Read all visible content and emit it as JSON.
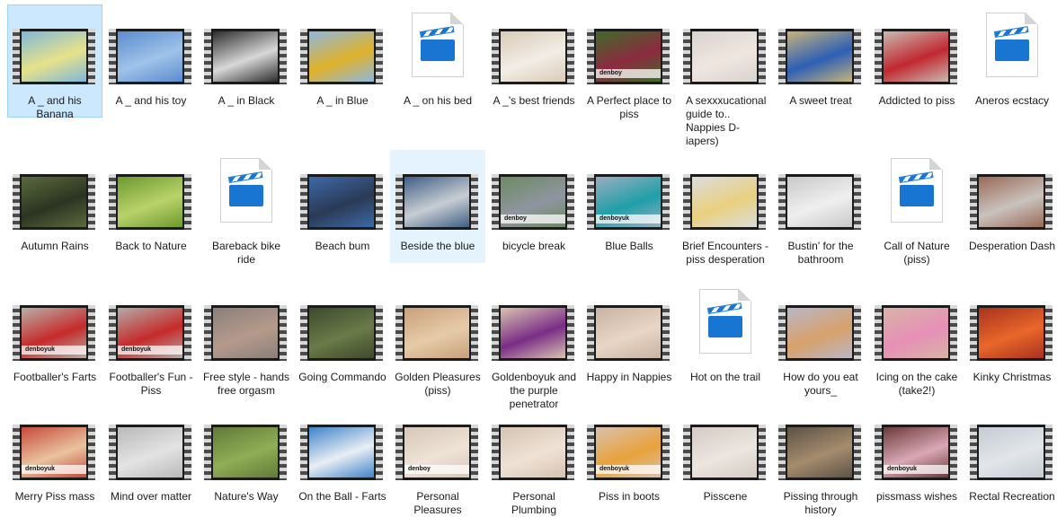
{
  "explorer": {
    "items": [
      {
        "name": "A _ and his Banana",
        "kind": "video",
        "bg": "#7fb7da",
        "fg": "#e7e28a",
        "selected": true
      },
      {
        "name": "A _ and his toy",
        "kind": "video",
        "bg": "#5a8ccf",
        "fg": "#9fc3e9"
      },
      {
        "name": "A _ in Black",
        "kind": "video",
        "bg": "#2d2d2d",
        "fg": "#d8d8d8"
      },
      {
        "name": "A _ in Blue",
        "kind": "video",
        "bg": "#8eb7de",
        "fg": "#e0b22a"
      },
      {
        "name": "A _ on his bed",
        "kind": "file"
      },
      {
        "name": "A _'s best friends",
        "kind": "video",
        "bg": "#d9cbb7",
        "fg": "#f2ede6"
      },
      {
        "name": "A Perfect place to piss",
        "kind": "video",
        "bg": "#3f6b2a",
        "fg": "#8d2a3f",
        "logo": "denboy"
      },
      {
        "name": "A sexxxucational guide to.. Nappies D-iapers)",
        "kind": "video",
        "bg": "#d8d3ce",
        "fg": "#efe6df"
      },
      {
        "name": "A sweet treat",
        "kind": "video",
        "bg": "#c7b37b",
        "fg": "#2c5fb5"
      },
      {
        "name": "Addicted to piss",
        "kind": "video",
        "bg": "#c9b9b1",
        "fg": "#c12830"
      },
      {
        "name": "Aneros ecstacy",
        "kind": "file"
      },
      {
        "name": "Autumn Rains",
        "kind": "video",
        "bg": "#5a6b3e",
        "fg": "#2c3421"
      },
      {
        "name": "Back to Nature",
        "kind": "video",
        "bg": "#6c9a2d",
        "fg": "#b9d26a"
      },
      {
        "name": "Bareback bike ride",
        "kind": "file"
      },
      {
        "name": "Beach bum",
        "kind": "video",
        "bg": "#3e69a8",
        "fg": "#2a3a55"
      },
      {
        "name": "Beside the blue",
        "kind": "video",
        "bg": "#3f5f86",
        "fg": "#c8cdd2",
        "hover": true
      },
      {
        "name": "bicycle break",
        "kind": "video",
        "bg": "#6d8a62",
        "fg": "#8f95a0",
        "logo": "denboy"
      },
      {
        "name": "Blue Balls",
        "kind": "video",
        "bg": "#9aaec0",
        "fg": "#1f9fa8",
        "logo": "denboyuk"
      },
      {
        "name": "Brief Encounters - piss desperation",
        "kind": "video",
        "bg": "#dcdcdc",
        "fg": "#e9d07f"
      },
      {
        "name": "Bustin' for the bathroom",
        "kind": "video",
        "bg": "#c9c9c9",
        "fg": "#efefef"
      },
      {
        "name": "Call of Nature (piss)",
        "kind": "file"
      },
      {
        "name": "Desperation Dash",
        "kind": "video",
        "bg": "#9a6a56",
        "fg": "#c9c3be"
      },
      {
        "name": "Footballer's Farts",
        "kind": "video",
        "bg": "#b8b0a8",
        "fg": "#c62a2a",
        "logo": "denboyuk"
      },
      {
        "name": "Footballer's Fun - Piss",
        "kind": "video",
        "bg": "#b3aca7",
        "fg": "#c62a2a",
        "logo": "denboyuk"
      },
      {
        "name": "Free style - hands free orgasm",
        "kind": "video",
        "bg": "#8b7f79",
        "fg": "#b59a8c"
      },
      {
        "name": "Going Commando",
        "kind": "video",
        "bg": "#3c4a2c",
        "fg": "#6a7a48"
      },
      {
        "name": "Golden Pleasures (piss)",
        "kind": "video",
        "bg": "#c8a07a",
        "fg": "#e6cba9"
      },
      {
        "name": "Goldenboyuk and the purple penetrator",
        "kind": "video",
        "bg": "#d9c3b0",
        "fg": "#7a2d86"
      },
      {
        "name": "Happy in Nappies",
        "kind": "video",
        "bg": "#c9b2a1",
        "fg": "#e8d6c6"
      },
      {
        "name": "Hot on the trail",
        "kind": "file"
      },
      {
        "name": "How do you eat yours_",
        "kind": "video",
        "bg": "#b9b7c7",
        "fg": "#d7a16a"
      },
      {
        "name": "Icing on the cake (take2!)",
        "kind": "video",
        "bg": "#d8b4a6",
        "fg": "#e78fb7"
      },
      {
        "name": "Kinky Christmas",
        "kind": "video",
        "bg": "#a8321e",
        "fg": "#e9672a"
      },
      {
        "name": "Merry Piss mass",
        "kind": "video",
        "bg": "#c74a3a",
        "fg": "#e9c39f",
        "logo": "denboyuk"
      },
      {
        "name": "Mind over matter",
        "kind": "video",
        "bg": "#b9b9b9",
        "fg": "#e3e3e3"
      },
      {
        "name": "Nature's Way",
        "kind": "video",
        "bg": "#5f7a3a",
        "fg": "#8fae55"
      },
      {
        "name": "On the Ball - Farts",
        "kind": "video",
        "bg": "#3e84c9",
        "fg": "#e9eef4"
      },
      {
        "name": "Personal Pleasures",
        "kind": "video",
        "bg": "#d6c7b8",
        "fg": "#eee3d6",
        "logo": "denboy"
      },
      {
        "name": "Personal Plumbing",
        "kind": "video",
        "bg": "#d5c3b4",
        "fg": "#efe2d5"
      },
      {
        "name": "Piss in boots",
        "kind": "video",
        "bg": "#d9c1ae",
        "fg": "#e8a23a",
        "logo": "denboyuk"
      },
      {
        "name": "Pisscene",
        "kind": "video",
        "bg": "#d4cbc3",
        "fg": "#ece6e0"
      },
      {
        "name": "Pissing through history",
        "kind": "video",
        "bg": "#5d5246",
        "fg": "#a58c6d"
      },
      {
        "name": "pissmass wishes",
        "kind": "video",
        "bg": "#6a3b3a",
        "fg": "#d9a8b5",
        "logo": "denboyuk"
      },
      {
        "name": "Rectal Recreation",
        "kind": "video",
        "bg": "#c5cbd2",
        "fg": "#e2e6ea"
      }
    ]
  }
}
